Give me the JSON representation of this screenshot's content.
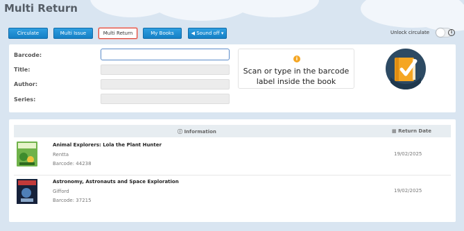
{
  "page": {
    "title": "Multi Return"
  },
  "toolbar": {
    "circulate_label": "Circulate",
    "multi_issue_label": "Multi Issue",
    "multi_return_label": "Multi Return",
    "my_books_label": "My Books",
    "sound_off_label": "◀ Sound off ▾",
    "unlock_label": "Unlock circulate",
    "unlock_on": false
  },
  "form": {
    "barcode_label": "Barcode:",
    "title_label": "Title:",
    "author_label": "Author:",
    "series_label": "Series:",
    "barcode_value": "",
    "title_value": "",
    "author_value": "",
    "series_value": ""
  },
  "hint": {
    "icon": "info-circle-icon",
    "text": "Scan or type in the barcode label inside the book"
  },
  "results": {
    "header_info": "Information",
    "header_date": "Return Date",
    "rows": [
      {
        "title": "Animal Explorers: Lola the Plant Hunter",
        "author": "Rentta",
        "barcode": "Barcode: 44238",
        "date": "19/02/2025"
      },
      {
        "title": "Astronomy, Astronauts and Space Exploration",
        "author": "Gifford",
        "barcode": "Barcode: 37215",
        "date": "19/02/2025"
      }
    ]
  },
  "colors": {
    "button_blue": "#1a8ad4",
    "active_border": "#d9453a",
    "logo_circle": "#2d4a63",
    "hint_icon": "#f5a623",
    "page_bg": "#d9e5f1"
  }
}
